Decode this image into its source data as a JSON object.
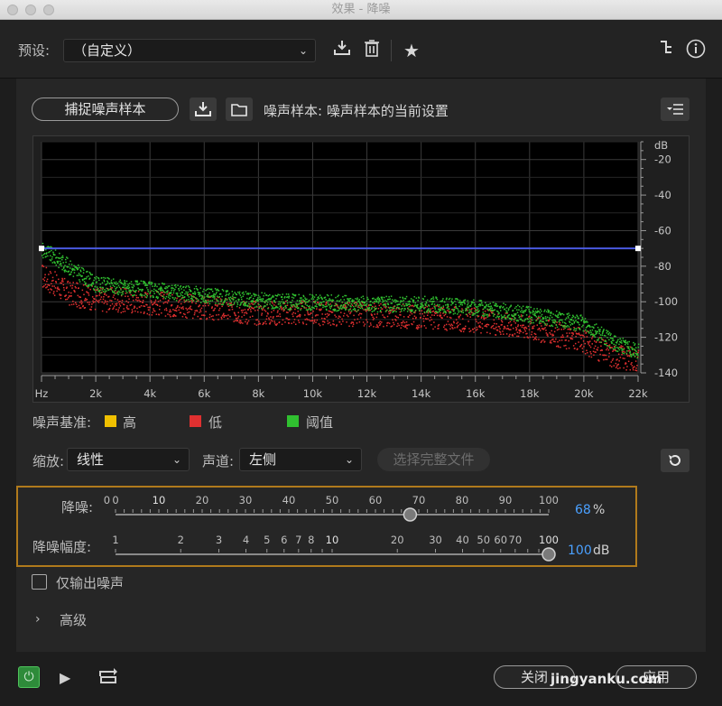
{
  "window": {
    "title": "效果 - 降噪"
  },
  "preset": {
    "label": "预设:",
    "value": "（自定义）"
  },
  "toolbar": {
    "save_preset_icon": "download-icon",
    "delete_preset_icon": "trash-icon",
    "favorite_icon": "star-icon",
    "routing_icon": "routing-icon",
    "info_icon": "info-icon"
  },
  "capture": {
    "button_label": "捕捉噪声样本",
    "sample_label": "噪声样本: 噪声样本的当前设置"
  },
  "chart": {
    "y_unit": "dB",
    "y_ticks": [
      "-20",
      "-40",
      "-60",
      "-80",
      "-100",
      "-120",
      "-140"
    ],
    "x_ticks": [
      "Hz",
      "2k",
      "4k",
      "6k",
      "8k",
      "10k",
      "12k",
      "14k",
      "16k",
      "18k",
      "20k",
      "22k"
    ]
  },
  "chart_data": {
    "type": "scatter",
    "title": "",
    "xlabel": "",
    "ylabel": "dB",
    "xlim": [
      0,
      22000
    ],
    "ylim": [
      -140,
      -10
    ],
    "threshold_line": {
      "value": -70,
      "color": "#4a5ae0"
    },
    "series": [
      {
        "name": "高",
        "color": "#f0c000",
        "values": []
      },
      {
        "name": "低",
        "color": "#e03030",
        "x": [
          0,
          1000,
          2000,
          4000,
          6000,
          8000,
          10000,
          12000,
          14000,
          16000,
          18000,
          20000,
          21000,
          22000
        ],
        "values": [
          -85,
          -95,
          -98,
          -100,
          -103,
          -106,
          -106,
          -107,
          -108,
          -110,
          -114,
          -122,
          -130,
          -132
        ]
      },
      {
        "name": "阈值",
        "color": "#30c030",
        "x": [
          0,
          1000,
          2000,
          4000,
          6000,
          8000,
          10000,
          12000,
          14000,
          16000,
          18000,
          20000,
          21000,
          22000
        ],
        "values": [
          -70,
          -80,
          -90,
          -93,
          -96,
          -99,
          -100,
          -101,
          -101,
          -103,
          -107,
          -112,
          -122,
          -128
        ]
      }
    ]
  },
  "legend": {
    "title": "噪声基准:",
    "items": [
      {
        "label": "高",
        "color": "#f0c000"
      },
      {
        "label": "低",
        "color": "#e03030"
      },
      {
        "label": "阈值",
        "color": "#30c030"
      }
    ]
  },
  "scale": {
    "label": "缩放:",
    "value": "线性"
  },
  "channel": {
    "label": "声道:",
    "value": "左侧"
  },
  "select_file_button": "选择完整文件",
  "reduction": {
    "label": "降噪:",
    "ticks": [
      "0",
      "0",
      "10",
      "20",
      "30",
      "40",
      "50",
      "60",
      "70",
      "80",
      "90",
      "100"
    ],
    "value": "68",
    "unit": "%",
    "level": 68
  },
  "amount": {
    "label": "降噪幅度:",
    "ticks": [
      "1",
      "2",
      "3",
      "4",
      "5",
      "6",
      "7",
      "8",
      "10",
      "20",
      "30",
      "40",
      "50",
      "60",
      "70",
      "100"
    ],
    "value": "100",
    "unit": "dB",
    "level": 100
  },
  "output_noise_only": {
    "label": "仅输出噪声",
    "checked": false
  },
  "advanced": {
    "label": "高级"
  },
  "footer": {
    "close_label": "关闭",
    "apply_label": "应用",
    "watermark": "jingyanku.com"
  }
}
